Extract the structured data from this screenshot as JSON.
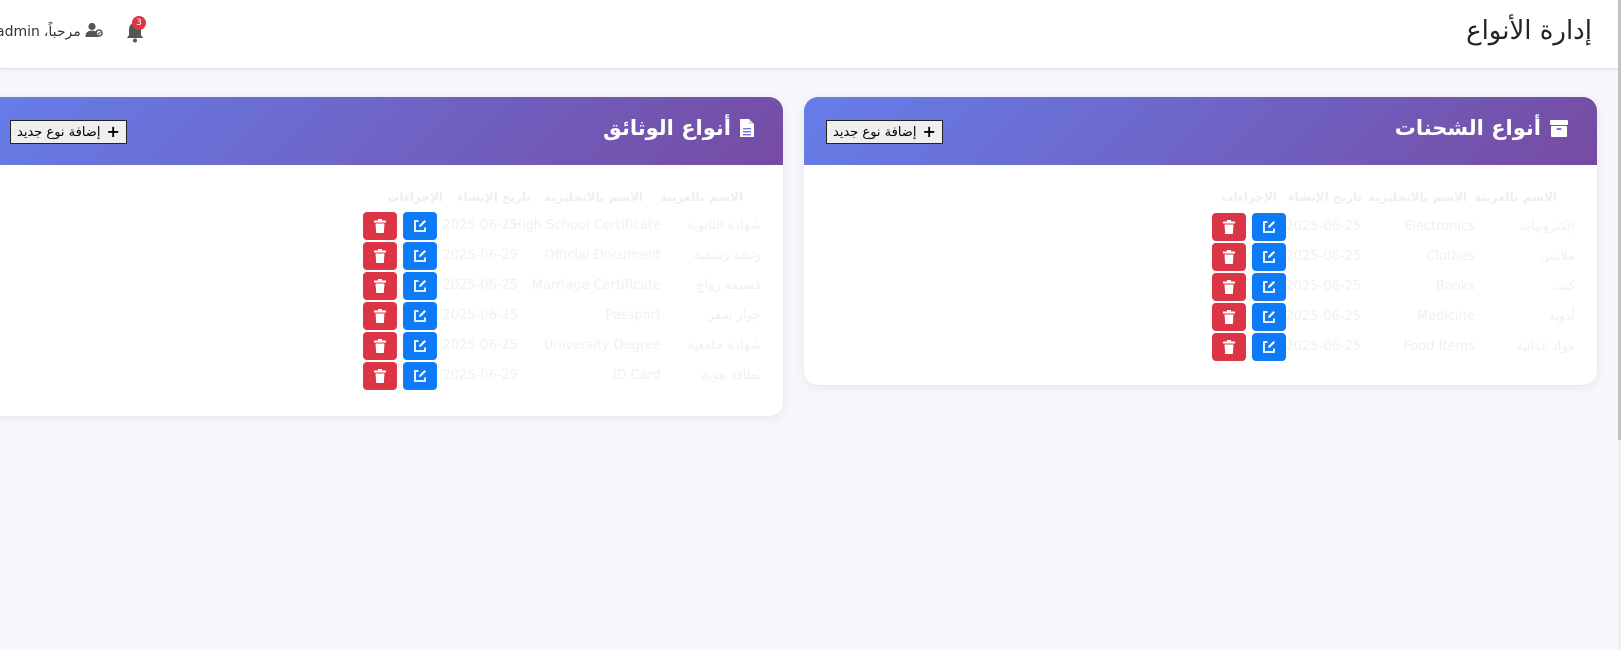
{
  "header": {
    "title": "إدارة الأنواع",
    "greeting": "مرحباً،",
    "username": "admin",
    "notification_count": "3"
  },
  "shipment_types": {
    "title": "أنواع الشحنات",
    "add_button": "إضافة نوع جديد",
    "columns": [
      "الاسم بالعربية",
      "الاسم بالانجليزية",
      "تاريخ الإنشاء",
      "الإجراءات"
    ],
    "rows": [
      {
        "ar": "إلكترونيات",
        "en": "Electronics",
        "date": "2025-06-25"
      },
      {
        "ar": "ملابس",
        "en": "Clothes",
        "date": "2025-06-25"
      },
      {
        "ar": "كتب",
        "en": "Books",
        "date": "2025-06-25"
      },
      {
        "ar": "أدوية",
        "en": "Medicine",
        "date": "2025-06-25"
      },
      {
        "ar": "مواد غذائية",
        "en": "Food Items",
        "date": "2025-06-25"
      }
    ]
  },
  "document_types": {
    "title": "أنواع الوثائق",
    "add_button": "إضافة نوع جديد",
    "columns": [
      "الاسم بالعربية",
      "الاسم بالانجليزية",
      "تاريخ الإنشاء",
      "الإجراءات"
    ],
    "rows": [
      {
        "ar": "شهادة الثانوية",
        "en": "High School Certificate",
        "date": "2025-06-25"
      },
      {
        "ar": "وثيقة رسمية",
        "en": "Official Document",
        "date": "2025-06-25"
      },
      {
        "ar": "قسيمة زواج",
        "en": "Marriage Certificate",
        "date": "2025-06-25"
      },
      {
        "ar": "جواز سفر",
        "en": "Passport",
        "date": "2025-06-25"
      },
      {
        "ar": "شهادة جامعية",
        "en": "University Degree",
        "date": "2025-06-25"
      },
      {
        "ar": "بطاقة هوية",
        "en": "ID Card",
        "date": "2025-06-25"
      }
    ]
  },
  "colors": {
    "header_gradient_start": "#667eea",
    "header_gradient_end": "#764ba2",
    "edit_button": "#0d7bf7",
    "delete_button": "#dc3545"
  },
  "icons": {
    "shipment": "box-icon",
    "document": "file-icon",
    "edit": "edit-icon",
    "delete": "trash-icon",
    "bell": "bell-icon",
    "user": "user-icon",
    "add": "plus-icon"
  }
}
